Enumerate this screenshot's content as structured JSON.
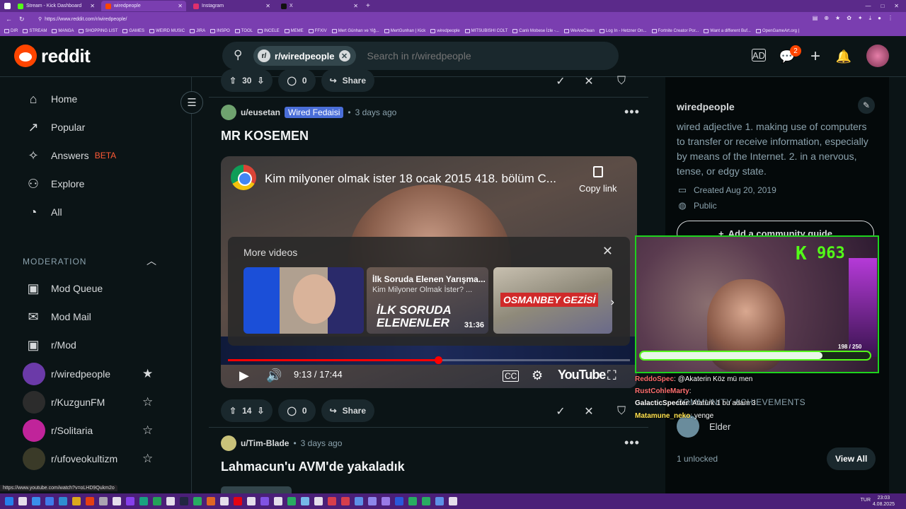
{
  "browser": {
    "tabs": [
      {
        "label": "Stream - Kick Dashboard",
        "color": "#53fc18",
        "active": false
      },
      {
        "label": "wiredpeople",
        "color": "#ff4500",
        "active": true
      },
      {
        "label": "Instagram",
        "color": "#e1306c",
        "active": false
      },
      {
        "label": "X",
        "color": "#111111",
        "active": false
      }
    ],
    "url": "https://www.reddit.com/r/wiredpeople/",
    "bookmarks": [
      "DIR",
      "STREAM",
      "MANGA",
      "SHOPPING LIST",
      "GAMES",
      "WEIRD MUSIC",
      "JIRA",
      "INSPO",
      "TOOL",
      "INCELE",
      "MEME",
      "FFXIV",
      "Mert Günhan ve Yiğ...",
      "MertGunhan | Kick",
      "wiredpeople",
      "MITSUBISHI COLT",
      "Canlı Mobese İzle -...",
      "WeAreClean",
      "Log In - Hetzner On...",
      "Fortnite Creator Por...",
      "Want a different Buf...",
      "OpenGameArt.org |"
    ],
    "status_url": "https://www.youtube.com/watch?v=oLHD9Qukm2o"
  },
  "header": {
    "logo_text": "reddit",
    "search_chip": "r/wiredpeople",
    "search_placeholder": "Search in r/wiredpeople",
    "chat_badge": "2"
  },
  "sidebar": {
    "nav": [
      {
        "label": "Home",
        "icon": "home-icon",
        "glyph": "⌂"
      },
      {
        "label": "Popular",
        "icon": "popular-icon",
        "glyph": "↗"
      },
      {
        "label": "Answers",
        "icon": "answers-icon",
        "glyph": "✧"
      },
      {
        "label": "Explore",
        "icon": "explore-icon",
        "glyph": "⚇"
      },
      {
        "label": "All",
        "icon": "all-icon",
        "glyph": "◔"
      }
    ],
    "beta": "BETA",
    "moderation_label": "MODERATION",
    "mod_items": [
      {
        "label": "Mod Queue",
        "icon": "mod-queue-icon",
        "glyph": "▣"
      },
      {
        "label": "Mod Mail",
        "icon": "mod-mail-icon",
        "glyph": "✉"
      },
      {
        "label": "r/Mod",
        "icon": "mod-icon",
        "glyph": "▣"
      }
    ],
    "communities": [
      {
        "label": "r/wiredpeople",
        "color": "#6b3aa8",
        "starred": true
      },
      {
        "label": "r/KuzgunFM",
        "color": "#2c2c2c",
        "starred": false
      },
      {
        "label": "r/Solitaria",
        "color": "#c0249a",
        "starred": false
      },
      {
        "label": "r/ufoveokultizm",
        "color": "#3a3a28",
        "starred": false
      }
    ]
  },
  "posts": [
    {
      "upvotes": "30",
      "comments": "0",
      "share": "Share"
    },
    {
      "author": "u/eusetan",
      "flair": "Wired Fedaisi",
      "time": "3 days ago",
      "title": "MR KOSEMEN",
      "upvotes": "14",
      "comments": "0",
      "share": "Share",
      "video": {
        "title": "Kim milyoner olmak ister 18 ocak 2015 418. bölüm C...",
        "copy_link": "Copy link",
        "more_videos": "More videos",
        "thumbs": [
          {
            "title": "",
            "channel": "",
            "duration": "",
            "big": ""
          },
          {
            "title": "İlk Soruda Elenen Yarışma...",
            "channel": "Kim Milyoner Olmak İster? ...",
            "duration": "31:36",
            "big": "İLK SORUDA ELENENLER"
          },
          {
            "title": "",
            "channel": "",
            "duration": "",
            "big": "OSMANBEY GEZİSİ"
          }
        ],
        "time": "9:13 / 17:44",
        "progress": 0.523,
        "brand": "YouTube"
      }
    },
    {
      "author": "u/Tim-Blade",
      "time": "3 days ago",
      "title": "Lahmacun'u AVM'de yakaladık"
    }
  ],
  "right": {
    "name": "wiredpeople",
    "description": "wired adjective 1. making use of computers to transfer or receive information, especially by means of the Internet. 2. in a nervous, tense, or edgy state.",
    "created": "Created Aug 20, 2019",
    "visibility": "Public",
    "guide": "Add a community guide",
    "achievements": "COMMUNITY ACHIEVEMENTS",
    "elder": "Elder",
    "unlocked": "1 unlocked",
    "view_all": "View All"
  },
  "stream": {
    "kick_logo": "K",
    "viewers": "963",
    "sub_progress": "198 / 250",
    "sub_fraction": 0.792,
    "chat": [
      {
        "user": "ReddoSpec",
        "color": "#ff6b6b",
        "msg": ": @Akaterin Köz mü men"
      },
      {
        "user": "RustCohleMarty",
        "color": "#ff7070",
        "msg": ":"
      },
      {
        "user": "GalacticSpecter",
        "color": "#ffffff",
        "msg": ": Atatürk 1 bu adam 3"
      },
      {
        "user": "Matamune_neko",
        "color": "#ffe14d",
        "msg": ": yenge"
      }
    ]
  },
  "taskbar": {
    "clock_time": "23:03",
    "clock_date": "4.08.2025",
    "lang": "TUR",
    "app_colors": [
      "#1e90ff",
      "#ffffff",
      "#36a3ff",
      "#3d8bfd",
      "#2aa1e0",
      "#f4c20d",
      "#ff4500",
      "#bbbbbb",
      "#ffffff",
      "#9146ff",
      "#10b981",
      "#1db954",
      "#ffffff",
      "#1b2838",
      "#22c55e",
      "#f97316",
      "#ffffff",
      "#ff0000",
      "#ffffff",
      "#8b5cf6",
      "#ffffff",
      "#22c55e",
      "#7dd3fc",
      "#ffffff",
      "#ef4444",
      "#ef4444",
      "#60a5fa",
      "#9999ff",
      "#a78bfa",
      "#2563eb",
      "#22c55e",
      "#22c55e",
      "#60a5fa",
      "#ffffff"
    ]
  }
}
